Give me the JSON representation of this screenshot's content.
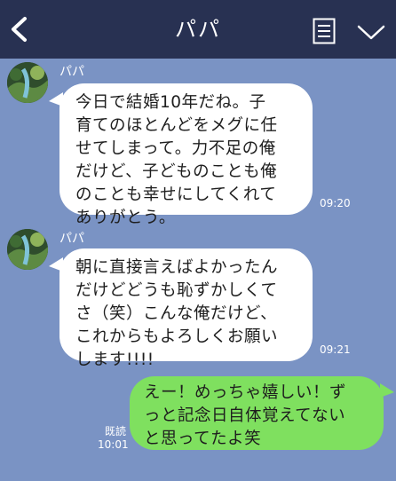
{
  "header": {
    "title": "パパ",
    "back_icon": "chevron-left-icon",
    "notes_icon": "notes-icon",
    "menu_icon": "chevron-down-icon",
    "bg_color": "#283152"
  },
  "chat": {
    "bg_color": "#7a93c4",
    "messages": [
      {
        "sender": "パパ",
        "text": "今日で結婚10年だね。子\n育てのほとんどをメグに任\nせてしまって。力不足の俺\nだけど、子どものことも俺\nのことも幸せにしてくれて\nありがとう。",
        "time": "09:20"
      },
      {
        "sender": "パパ",
        "text": "朝に直接言えばよかったん\nだけどどうも恥ずかしくて\nさ（笑）こんな俺だけど、\nこれからもよろしくお願い\nします!!!!",
        "time": "09:21"
      }
    ],
    "reply": {
      "text": "えー！めっちゃ嬉しい！ず\nっと記念日自体覚えてない\nと思ってたよ笑",
      "read_label": "既読",
      "time": "10:01",
      "bubble_color": "#7fe05f"
    }
  }
}
